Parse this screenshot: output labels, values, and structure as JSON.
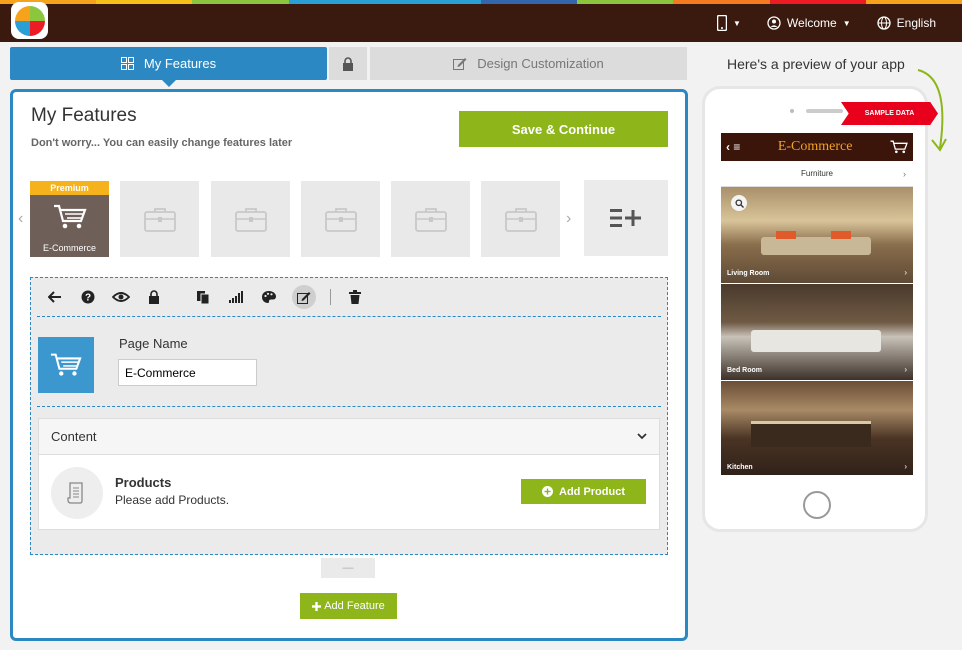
{
  "topbar": {
    "device_label": "",
    "welcome_label": "Welcome",
    "language_label": "English",
    "stripe_colors": [
      "#f6a21a",
      "#f6c21a",
      "#8cc63e",
      "#2a9fd6",
      "#2a9fd6",
      "#3366aa",
      "#8cc63e",
      "#f47b20",
      "#ed1c24",
      "#f6a21a"
    ]
  },
  "tabs": {
    "my_features": "My Features",
    "design": "Design Customization"
  },
  "main": {
    "title": "My Features",
    "subtitle": "Don't worry... You can easily change features later",
    "save_label": "Save & Continue"
  },
  "features": {
    "active": {
      "badge": "Premium",
      "label": "E-Commerce",
      "icon": "cart-icon"
    },
    "placeholders": 5,
    "placeholder_icon": "briefcase-icon",
    "add_icon": "add-list-icon"
  },
  "editor": {
    "toolbar_icons": [
      "back-icon",
      "help-icon",
      "eye-icon",
      "lock-icon",
      "copy-icon",
      "signal-icon",
      "palette-icon",
      "edit-icon",
      "trash-icon"
    ],
    "page_name_label": "Page Name",
    "page_name_value": "E-Commerce",
    "content_header": "Content",
    "products_title": "Products",
    "products_sub": "Please add Products.",
    "add_product_label": "Add Product",
    "collapse_symbol": "—"
  },
  "add_feature_label": "Add Feature",
  "preview": {
    "title": "Here's a preview of your app",
    "ribbon": "SAMPLE DATA",
    "app_title": "E-Commerce",
    "app_subtitle": "Furniture",
    "rooms": [
      {
        "label": "Living Room"
      },
      {
        "label": "Bed Room"
      },
      {
        "label": "Kitchen"
      }
    ]
  },
  "colors": {
    "accent_blue": "#2c88c3",
    "accent_green": "#8eb51a",
    "topbar_bg": "#3a1a0e",
    "premium": "#f5b21c",
    "ribbon_red": "#e8001c"
  }
}
